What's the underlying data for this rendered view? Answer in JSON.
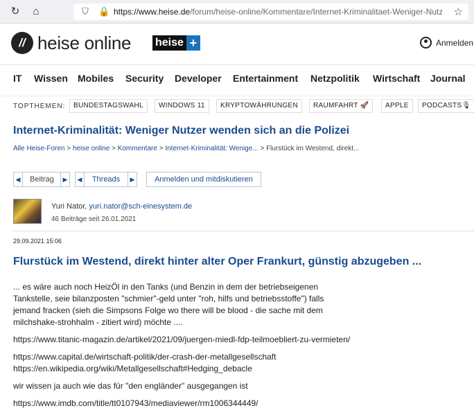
{
  "browser": {
    "url_host": "https://www.heise.de",
    "url_path": "/forum/heise-online/Kommentare/Internet-Kriminalitaet-Weniger-Nutze"
  },
  "header": {
    "logo_mark": "//",
    "logo_text": "heise online",
    "plus_left": "heise",
    "plus_right": "+",
    "login_label": "Anmelden"
  },
  "nav": [
    "IT",
    "Wissen",
    "Mobiles",
    "Security",
    "Developer",
    "Entertainment",
    "Netzpolitik",
    "Wirtschaft",
    "Journal"
  ],
  "topics": {
    "label": "TOPTHEMEN:",
    "items": [
      "BUNDESTAGSWAHL",
      "WINDOWS 11",
      "KRYPTOWÄHRUNGEN",
      "RAUMFAHRT 🚀",
      "APPLE",
      "PODCASTS🎙"
    ]
  },
  "page_title": "Internet-Kriminalität: Weniger Nutzer wenden sich an die Polizei",
  "breadcrumb": {
    "items": [
      "Alle Heise-Foren",
      "heise online",
      "Kommentare",
      "Internet-Kriminalität: Wenige..."
    ],
    "separator": ">",
    "current": "Flurstück im Westend, direkt..."
  },
  "controls": {
    "post_label": "Beitrag",
    "threads_label": "Threads",
    "login_discuss": "Anmelden und mitdiskutieren",
    "prev_arrow": "◀",
    "next_arrow": "▶"
  },
  "author": {
    "name": "Yuri Nator,",
    "email": "yuri.nator@sch-einesystem.de",
    "stats": "46 Beiträge seit 26.01.2021"
  },
  "post": {
    "date": "29.09.2021 15:06",
    "title": "Flurstück im Westend, direkt hinter alter Oper Frankurt, günstig abzugeben ...",
    "lines": [
      "... es wäre auch noch HeizÖl in den Tanks (und Benzin in dem der betriebseigenen",
      "Tankstelle, seie bilanzposten \"schmier\"-geld unter \"roh, hilfs und betriebsstoffe\") falls",
      "jemand fracken (sieh die Simpsons Folge wo there will be blood - die sache mit dem",
      "milchshake-strohhalm - zitiert wird) möchte ....",
      "https://www.titanic-magazin.de/artikel/2021/09/juergen-miedl-fdp-teilmoebliert-zu-vermieten/",
      "https://www.capital.de/wirtschaft-politik/der-crash-der-metallgesellschaft",
      "https://en.wikipedia.org/wiki/Metallgesellschaft#Hedging_debacle",
      "wir wissen ja auch wie das für \"den engländer\" ausgegangen ist",
      "https://www.imdb.com/title/tt0107943/mediaviewer/rm1006344449/"
    ]
  }
}
